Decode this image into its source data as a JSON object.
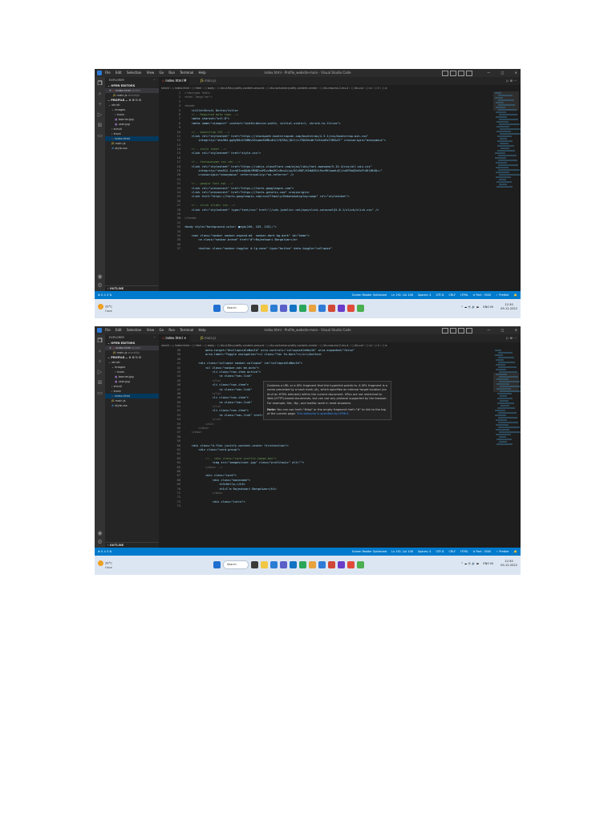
{
  "window": {
    "title": "index.html - Profile_website-main - Visual Studio Code",
    "menu": [
      "File",
      "Edit",
      "Selection",
      "View",
      "Go",
      "Run",
      "Terminal",
      "Help"
    ],
    "controls": [
      "—",
      "□",
      "✕"
    ]
  },
  "sidebar": {
    "header": "EXPLORER",
    "dots": "···",
    "open_editors": "OPEN EDITORS",
    "open_files": [
      {
        "close": "✕",
        "name": "index.html",
        "folder": "shruti"
      },
      {
        "close": "",
        "name": "main.js",
        "folder": "shruti/js"
      }
    ],
    "project": "PROFILE...",
    "tree": [
      "shruti",
      "images",
      "icons",
      "banner.jpg",
      "user.jpg",
      "shruti",
      "track",
      "index.html",
      "main.js",
      "style.css"
    ],
    "outline": "OUTLINE"
  },
  "tabs": [
    {
      "name": "index.html",
      "modified_1": "M",
      "close_2": "✕"
    },
    {
      "name": "main.js"
    }
  ],
  "tab_actions": "▷  ⊞  ···",
  "screen1": {
    "breadcrumb": "shruti › ◇ index.html › ⬡ html › ⬡ body › ⬡ div.d-flex.justify-content-around › ⬡ div.container.justify-content-center › ⬡ div.row.md-2.ms-4 › ⬡ div.col › ⬡ ul › ⬡ li › ⬡ a",
    "line_numbers": [
      "1",
      "2",
      "3",
      "4",
      "5",
      "6",
      "7",
      "8",
      "9",
      "10",
      "11",
      "12",
      "13",
      "14",
      "15",
      "16",
      "17",
      "18",
      "19",
      "20",
      "21",
      "22",
      "23",
      "24",
      "25",
      "26",
      "27",
      "28",
      "29",
      "30",
      "31",
      "32",
      "33",
      "34",
      "35",
      "36",
      "37"
    ],
    "code": [
      "<!doctype html>",
      "<html lang=\"en\">",
      "",
      "<head>",
      "    <title>Shruti Dutta</title>",
      "    <!-- Required meta tags -->",
      "    <meta charset=\"utf-8\">",
      "    <meta name=\"viewport\" content=\"width=device-width, initial-scale=1, shrink-to-fit=no\">",
      "",
      "    <!-- bootstrap CSS -->",
      "    <link rel=\"stylesheet\" href=\"https://stackpath.bootstrapcdn.com/bootstrap/4.3.1/css/bootstrap.min.css\"",
      "        integrity=\"sha384-ggOyR0iXCbMQv3Xipma34MD+dH/1fQ784/j6cY/iJTQUOhcWr7x9JvoRxT2MZw1T\" crossorigin=\"anonymous\">",
      "",
      "    <!-- style sheet -->",
      "    <link rel=\"stylesheet\" href=\"style.css\">",
      "",
      "    <!-- fontawesome css cdn -->",
      "    <link rel=\"stylesheet\" href=\"https://cdnjs.cloudflare.com/ajax/libs/font-awesome/5.15.4/css/all.min.css\"",
      "        integrity=\"sha512-1ycn6IcaQQ40/MHBIvuM1zcNmJKlcHcwJ+Lp/OCcROF/K1WdG9Ji9xc9KtaaeLQC/cu6F0aQ3e5oFt4Kl0K4Q==\"",
      "        crossorigin=\"anonymous\" referrerpolicy=\"no-referrer\" />",
      "",
      "    <!-- google font api -->",
      "    <link rel=\"preconnect\" href=\"https://fonts.googleapis.com\">",
      "    <link rel=\"preconnect\" href=\"https://fonts.gstatic.com\" crossorigin>",
      "    <link href=\"https://fonts.googleapis.com/css2?family=Roboto&display=swap\" rel=\"stylesheet\">",
      "",
      "    <!-- slick slider css -->",
      "    <link rel=\"stylesheet\" type=\"text/css\" href=\"//cdn.jsdelivr.net/npm/slick-carousel@1.8.1/slick/slick.css\" />",
      "",
      "</head>",
      "",
      "<body style=\"background-color: ■rgb(246, 243, 243);\">",
      "",
      "    <nav class=\"navbar navbar-expand-md  navbar-dark bg-dark\" id=\"home\">",
      "        <a class=\"navbar-brand\" href=\"#\">Rajeshwari Bargalwar</a>",
      "",
      "        <button class=\"navbar-toggler d-lg-none\" type=\"button\" data-toggle=\"collapse\""
    ]
  },
  "screen2": {
    "breadcrumb": "shruti › ◇ index.html › ⬡ html › ⬡ body › ⬡ div.d-flex.justify-content-around › ⬡ div.container.justify-content-center › ⬡ div.row.md-2.ms-4 › ⬡ div.col › ⬡ ul › ⬡ li › ⬡ a",
    "line_numbers": [
      "38",
      "39",
      "40",
      "41",
      "42",
      "43",
      "44",
      "45",
      "46",
      "47",
      "48",
      "49",
      "50",
      "51",
      "52",
      "53",
      "54",
      "55",
      "56",
      "57",
      "58",
      "59",
      "60",
      "61",
      "62",
      "63",
      "64",
      "65",
      "66",
      "67",
      "68",
      "69",
      "70",
      "71",
      "72",
      "73",
      "74"
    ],
    "code": [
      "            data-target=\"#collapsibleNavId\" aria-controls=\"collapsibleNavId\" aria-expanded=\"false\"",
      "            aria-label=\"Toggle navigation\"><i class=\"fas fa-bars\"></i></button>",
      "",
      "        <div class=\"collapse navbar-collapse\" id=\"collapsibleNavId\">",
      "            <ul class=\"navbar-nav me-auto\">",
      "                <li class=\"nav-item active\">",
      "                    <a class=\"nav-link\"",
      "                </li>",
      "                <li class=\"nav-item\">",
      "                    <a class=\"nav-link\"",
      "                </li>",
      "                <li class=\"nav-item\">",
      "                    <a class=\"nav-link\"",
      "                </li>",
      "                <li class=\"nav-item\">",
      "                    <a class=\"nav-link\" href=\"#\">Contact</a>",
      "                </li>",
      "            </ul>",
      "        </div>",
      "    </nav>",
      "",
      "",
      "    <div class=\"d-flex justify-content-center firstsection\">",
      "        <div class=\"card-group\">",
      "",
      "            <!-- <div class=\"card profile-image-box\">",
      "                <img src=\"images/user.jpg\" class=\"profilepic\" alt=\"\">",
      "            </div> -->",
      "",
      "            <div class=\"card\">",
      "                <div class=\"mainname\">",
      "                    <h3>Hello,</h3>",
      "                    <h1>I'm Rajeshwari Bargalwar</h1>",
      "                </div>",
      "",
      "                <div class=\"intro\">",
      ""
    ],
    "hover": {
      "p1": "Contains a URL or a URL fragment that the hyperlink points to. A URL fragment is a name preceded by a hash mark (#), which specifies an internal target location (an id of an HTML element) within the current document. URLs are not restricted to Web (HTTP)-based documents, but can use any protocol supported by the browser. For example, file:, ftp:, and mailto: work in most browsers.",
      "p2_note": "Note:",
      "p2": " You can use href=\"#top\" or the empty fragment href=\"#\" to link to the top of the current page. ",
      "p2_link": "This behavior is specified by HTML5."
    }
  },
  "statusbar": {
    "left": "⊗ 0 ⚠ 0   ⇅",
    "items": [
      "Screen Reader Optimized",
      "Ln 192, Col 108",
      "Spaces: 4",
      "UTF-8",
      "CRLF",
      "HTML",
      "⊘ Port : 5500",
      "✓ Prettier",
      "🔔"
    ]
  },
  "taskbar": {
    "weather_temp": "29°C",
    "weather_desc": "Haze",
    "search": "Search",
    "tray_lang": "ENG IN",
    "time": "12:30",
    "date": "09-12-2022",
    "tray_icons": "^  ☁  ⦿  🔊  ▬"
  }
}
